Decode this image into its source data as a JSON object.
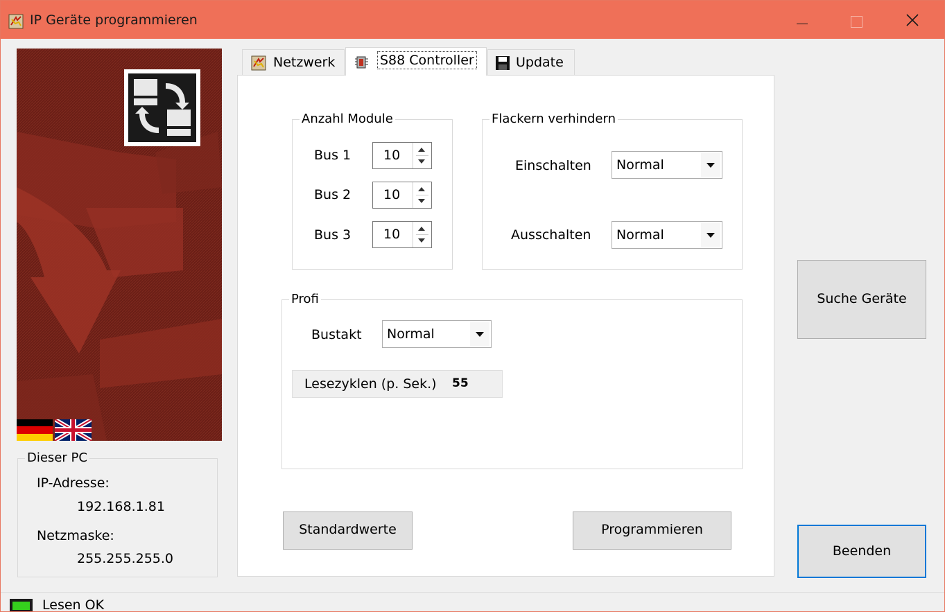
{
  "window": {
    "title": "IP Geräte programmieren",
    "accent": "#ef7058"
  },
  "tabs": [
    {
      "label": "Netzwerk",
      "icon": "network-icon",
      "active": false
    },
    {
      "label": "S88 Controller",
      "icon": "controller-icon",
      "active": true
    },
    {
      "label": "Update",
      "icon": "floppy-disk-icon",
      "active": false
    }
  ],
  "module_group": {
    "legend": "Anzahl Module",
    "buses": [
      {
        "label": "Bus 1",
        "value": "10"
      },
      {
        "label": "Bus 2",
        "value": "10"
      },
      {
        "label": "Bus 3",
        "value": "10"
      }
    ]
  },
  "flicker_group": {
    "legend": "Flackern verhindern",
    "on_label": "Einschalten",
    "on_value": "Normal",
    "off_label": "Ausschalten",
    "off_value": "Normal"
  },
  "profi_group": {
    "legend": "Profi",
    "bustakt_label": "Bustakt",
    "bustakt_value": "Normal",
    "cycles_label": "Lesezyklen (p. Sek.)",
    "cycles_value": "55"
  },
  "buttons": {
    "defaults": "Standardwerte",
    "program": "Programmieren",
    "search": "Suche Geräte",
    "exit": "Beenden"
  },
  "pc_group": {
    "legend": "Dieser PC",
    "ip_label": "IP-Adresse:",
    "ip_value": "192.168.1.81",
    "mask_label": "Netzmaske:",
    "mask_value": "255.255.255.0"
  },
  "status": {
    "text": "Lesen OK",
    "led_color": "#35d01d"
  }
}
